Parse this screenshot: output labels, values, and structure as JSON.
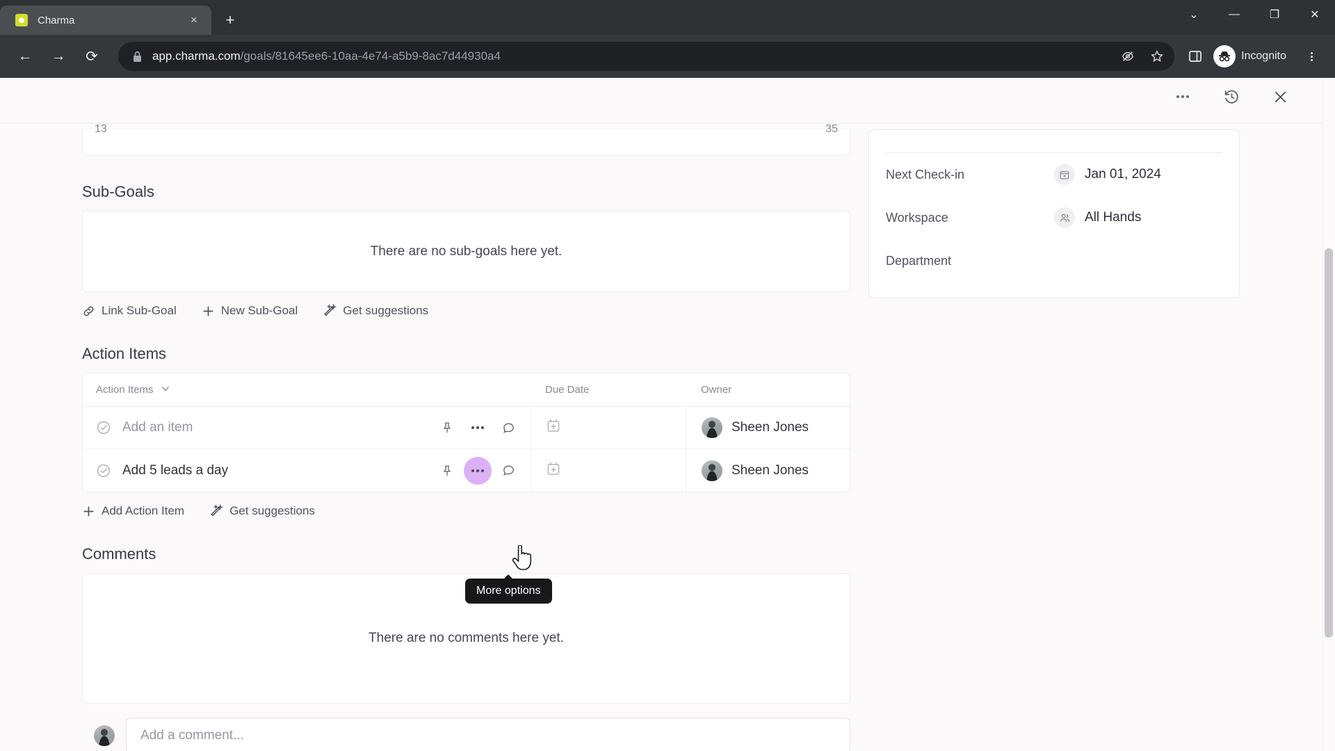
{
  "browser": {
    "tab": {
      "title": "Charma",
      "favicon": "charma-star-icon",
      "close_label": "×"
    },
    "new_tab_label": "+",
    "window_controls": {
      "more": "⌄",
      "minimize": "—",
      "maximize": "❐",
      "close": "✕"
    },
    "nav": {
      "back": "←",
      "forward": "→",
      "reload": "⟳"
    },
    "url": {
      "domain": "app.charma.com",
      "path": "/goals/81645ee6-10aa-4e74-a5b9-8ac7d44930a4"
    },
    "profile_label": "Incognito",
    "accent_favicon_color": "#d3dc30"
  },
  "panel_header": {
    "more_options": "more-options",
    "history": "history",
    "close": "close"
  },
  "partial_row": {
    "left_value": "13",
    "right_value": "35"
  },
  "sub_goals": {
    "title": "Sub-Goals",
    "empty_text": "There are no sub-goals here yet.",
    "actions": [
      {
        "label": "Link Sub-Goal",
        "icon": "link-icon"
      },
      {
        "label": "New Sub-Goal",
        "icon": "plus-icon"
      },
      {
        "label": "Get suggestions",
        "icon": "magic-wand-icon"
      }
    ]
  },
  "action_items": {
    "title": "Action Items",
    "columns": [
      "Action Items",
      "Due Date",
      "Owner"
    ],
    "rows": [
      {
        "text": "Add an item",
        "placeholder": true,
        "due_date": "",
        "owner": "Sheen Jones"
      },
      {
        "text": "Add 5 leads a day",
        "placeholder": false,
        "due_date": "",
        "owner": "Sheen Jones"
      }
    ],
    "actions": [
      {
        "label": "Add Action Item",
        "icon": "plus-icon"
      },
      {
        "label": "Get suggestions",
        "icon": "magic-wand-icon"
      }
    ],
    "tooltip": "More options",
    "highlight_color": "#c57ff0"
  },
  "comments": {
    "title": "Comments",
    "empty_text": "There are no comments here yet.",
    "input_placeholder": "Add a comment..."
  },
  "details": {
    "rows": [
      {
        "label": "Next Check-in",
        "value": "Jan 01, 2024",
        "icon": "calendar-icon"
      },
      {
        "label": "Workspace",
        "value": "All Hands",
        "icon": "people-icon"
      },
      {
        "label": "Department",
        "value": "",
        "icon": ""
      }
    ]
  }
}
